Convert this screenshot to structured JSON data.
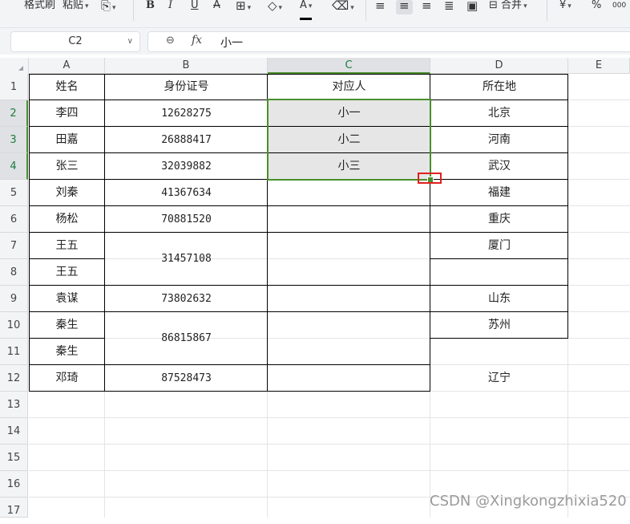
{
  "toolbar": {
    "format_painter": "格式刷",
    "paste": "粘贴",
    "bold": "B",
    "italic": "I",
    "underline": "U",
    "strike": "A",
    "font_color": "A",
    "merge": "合并",
    "currency": "¥",
    "percent": "%",
    "thousands": "000"
  },
  "formula": {
    "name_box": "C2",
    "fx": "fx",
    "value": "小一"
  },
  "columns": [
    "A",
    "B",
    "C",
    "D",
    "E"
  ],
  "rows": [
    "1",
    "2",
    "3",
    "4",
    "5",
    "6",
    "7",
    "8",
    "9",
    "10",
    "11",
    "12",
    "13",
    "14",
    "15",
    "16",
    "17"
  ],
  "cells": {
    "a1": "姓名",
    "b1": "身份证号",
    "c1": "对应人",
    "d1": "所在地",
    "a2": "李四",
    "b2": "12628275",
    "c2": "小一",
    "d2": "北京",
    "a3": "田嘉",
    "b3": "26888417",
    "c3": "小二",
    "d3": "河南",
    "a4": "张三",
    "b4": "32039882",
    "c4": "小三",
    "d4": "武汉",
    "a5": "刘秦",
    "b5": "41367634",
    "d5": "福建",
    "a6": "杨松",
    "b6": "70881520",
    "d6": "重庆",
    "a7": "王五",
    "b7": "31457108",
    "d7": "厦门",
    "a8": "王五",
    "a9": "袁谋",
    "b9": "73802632",
    "d9": "山东",
    "a10": "秦生",
    "b10": "86815867",
    "d10": "苏州",
    "a11": "秦生",
    "a12": "邓琦",
    "b12": "87528473",
    "d12": "辽宁"
  },
  "watermark": "CSDN @Xingkongzhixia520",
  "colors": {
    "selection": "#4a8f2e",
    "selected_fill": "#e6e6e6",
    "annotation": "#e02020"
  }
}
